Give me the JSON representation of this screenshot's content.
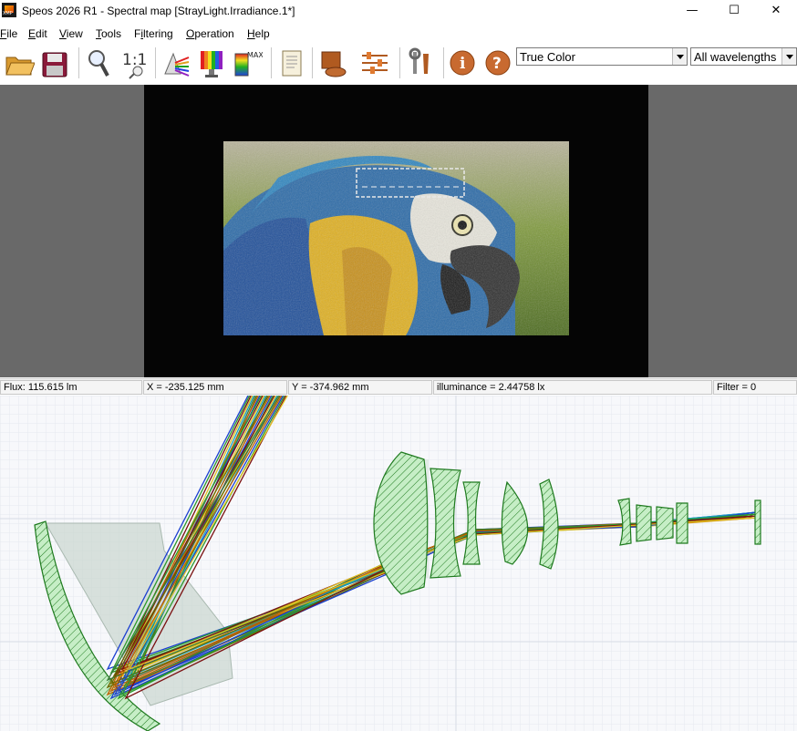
{
  "app": {
    "title": "Speos 2026 R1 - Spectral map [StrayLight.Irradiance.1*]",
    "logo_text": "XMP"
  },
  "window_controls": {
    "minimize": "—",
    "maximize": "☐",
    "close": "✕"
  },
  "menu": [
    {
      "label": "File",
      "mnemonic": "F"
    },
    {
      "label": "Edit",
      "mnemonic": "E"
    },
    {
      "label": "View",
      "mnemonic": "V"
    },
    {
      "label": "Tools",
      "mnemonic": "T"
    },
    {
      "label": "Filtering",
      "mnemonic": "i"
    },
    {
      "label": "Operation",
      "mnemonic": "O"
    },
    {
      "label": "Help",
      "mnemonic": "H"
    }
  ],
  "toolbar": {
    "buttons": [
      {
        "name": "open-folder-icon"
      },
      {
        "name": "save-disk-icon"
      },
      {
        "name": "magnifier-icon"
      },
      {
        "name": "zoom-1to1-icon",
        "label": "1:1"
      },
      {
        "name": "color-prism-icon"
      },
      {
        "name": "color-spectrum-icon"
      },
      {
        "name": "max-spectrum-icon",
        "label": "MAX"
      },
      {
        "name": "document-report-icon"
      },
      {
        "name": "surface-view-icon"
      },
      {
        "name": "settings-sliders-icon"
      },
      {
        "name": "tools-wrench-icon"
      },
      {
        "name": "info-icon",
        "label": "i"
      },
      {
        "name": "help-icon",
        "label": "?"
      }
    ],
    "color_mode": {
      "value": "True Color"
    },
    "wavelength": {
      "value": "All wavelengths"
    }
  },
  "status": {
    "flux": "Flux: 115.615 lm",
    "x": "X = -235.125 mm",
    "y": "Y = -374.962 mm",
    "illuminance": "illuminance = 2.44758 lx",
    "filter": "Filter = 0"
  },
  "colors": {
    "viewer_bg": "#696969",
    "image_frame": "#050505",
    "lens_fill": "#c6eec6",
    "lens_stroke": "#1e7a1e",
    "grid": "#dde2ea",
    "ray_colors": [
      "#1a3fd0",
      "#2b9a2b",
      "#7a1010",
      "#e0c020",
      "#18a0c0",
      "#3a7a3a",
      "#6a6a00",
      "#c06000"
    ]
  }
}
